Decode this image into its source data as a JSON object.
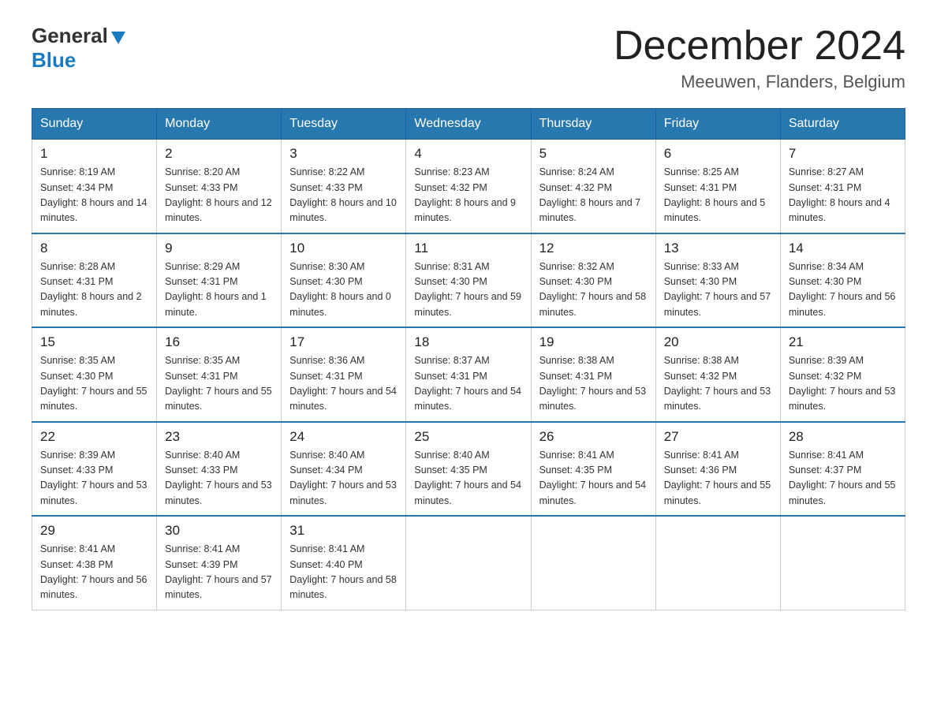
{
  "header": {
    "logo_general": "General",
    "logo_blue": "Blue",
    "title": "December 2024",
    "subtitle": "Meeuwen, Flanders, Belgium"
  },
  "days_of_week": [
    "Sunday",
    "Monday",
    "Tuesday",
    "Wednesday",
    "Thursday",
    "Friday",
    "Saturday"
  ],
  "weeks": [
    [
      {
        "day": "1",
        "sunrise": "8:19 AM",
        "sunset": "4:34 PM",
        "daylight": "8 hours and 14 minutes."
      },
      {
        "day": "2",
        "sunrise": "8:20 AM",
        "sunset": "4:33 PM",
        "daylight": "8 hours and 12 minutes."
      },
      {
        "day": "3",
        "sunrise": "8:22 AM",
        "sunset": "4:33 PM",
        "daylight": "8 hours and 10 minutes."
      },
      {
        "day": "4",
        "sunrise": "8:23 AM",
        "sunset": "4:32 PM",
        "daylight": "8 hours and 9 minutes."
      },
      {
        "day": "5",
        "sunrise": "8:24 AM",
        "sunset": "4:32 PM",
        "daylight": "8 hours and 7 minutes."
      },
      {
        "day": "6",
        "sunrise": "8:25 AM",
        "sunset": "4:31 PM",
        "daylight": "8 hours and 5 minutes."
      },
      {
        "day": "7",
        "sunrise": "8:27 AM",
        "sunset": "4:31 PM",
        "daylight": "8 hours and 4 minutes."
      }
    ],
    [
      {
        "day": "8",
        "sunrise": "8:28 AM",
        "sunset": "4:31 PM",
        "daylight": "8 hours and 2 minutes."
      },
      {
        "day": "9",
        "sunrise": "8:29 AM",
        "sunset": "4:31 PM",
        "daylight": "8 hours and 1 minute."
      },
      {
        "day": "10",
        "sunrise": "8:30 AM",
        "sunset": "4:30 PM",
        "daylight": "8 hours and 0 minutes."
      },
      {
        "day": "11",
        "sunrise": "8:31 AM",
        "sunset": "4:30 PM",
        "daylight": "7 hours and 59 minutes."
      },
      {
        "day": "12",
        "sunrise": "8:32 AM",
        "sunset": "4:30 PM",
        "daylight": "7 hours and 58 minutes."
      },
      {
        "day": "13",
        "sunrise": "8:33 AM",
        "sunset": "4:30 PM",
        "daylight": "7 hours and 57 minutes."
      },
      {
        "day": "14",
        "sunrise": "8:34 AM",
        "sunset": "4:30 PM",
        "daylight": "7 hours and 56 minutes."
      }
    ],
    [
      {
        "day": "15",
        "sunrise": "8:35 AM",
        "sunset": "4:30 PM",
        "daylight": "7 hours and 55 minutes."
      },
      {
        "day": "16",
        "sunrise": "8:35 AM",
        "sunset": "4:31 PM",
        "daylight": "7 hours and 55 minutes."
      },
      {
        "day": "17",
        "sunrise": "8:36 AM",
        "sunset": "4:31 PM",
        "daylight": "7 hours and 54 minutes."
      },
      {
        "day": "18",
        "sunrise": "8:37 AM",
        "sunset": "4:31 PM",
        "daylight": "7 hours and 54 minutes."
      },
      {
        "day": "19",
        "sunrise": "8:38 AM",
        "sunset": "4:31 PM",
        "daylight": "7 hours and 53 minutes."
      },
      {
        "day": "20",
        "sunrise": "8:38 AM",
        "sunset": "4:32 PM",
        "daylight": "7 hours and 53 minutes."
      },
      {
        "day": "21",
        "sunrise": "8:39 AM",
        "sunset": "4:32 PM",
        "daylight": "7 hours and 53 minutes."
      }
    ],
    [
      {
        "day": "22",
        "sunrise": "8:39 AM",
        "sunset": "4:33 PM",
        "daylight": "7 hours and 53 minutes."
      },
      {
        "day": "23",
        "sunrise": "8:40 AM",
        "sunset": "4:33 PM",
        "daylight": "7 hours and 53 minutes."
      },
      {
        "day": "24",
        "sunrise": "8:40 AM",
        "sunset": "4:34 PM",
        "daylight": "7 hours and 53 minutes."
      },
      {
        "day": "25",
        "sunrise": "8:40 AM",
        "sunset": "4:35 PM",
        "daylight": "7 hours and 54 minutes."
      },
      {
        "day": "26",
        "sunrise": "8:41 AM",
        "sunset": "4:35 PM",
        "daylight": "7 hours and 54 minutes."
      },
      {
        "day": "27",
        "sunrise": "8:41 AM",
        "sunset": "4:36 PM",
        "daylight": "7 hours and 55 minutes."
      },
      {
        "day": "28",
        "sunrise": "8:41 AM",
        "sunset": "4:37 PM",
        "daylight": "7 hours and 55 minutes."
      }
    ],
    [
      {
        "day": "29",
        "sunrise": "8:41 AM",
        "sunset": "4:38 PM",
        "daylight": "7 hours and 56 minutes."
      },
      {
        "day": "30",
        "sunrise": "8:41 AM",
        "sunset": "4:39 PM",
        "daylight": "7 hours and 57 minutes."
      },
      {
        "day": "31",
        "sunrise": "8:41 AM",
        "sunset": "4:40 PM",
        "daylight": "7 hours and 58 minutes."
      },
      null,
      null,
      null,
      null
    ]
  ],
  "labels": {
    "sunrise": "Sunrise:",
    "sunset": "Sunset:",
    "daylight": "Daylight:"
  }
}
